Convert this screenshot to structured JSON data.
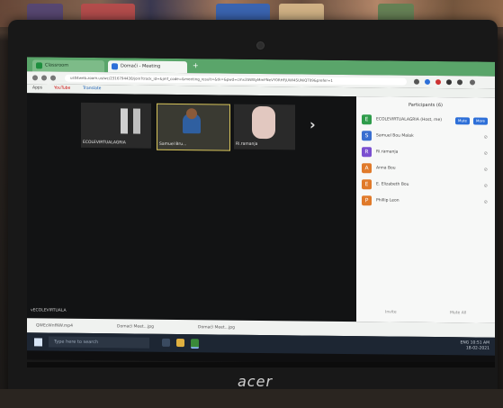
{
  "browser": {
    "tabs": [
      {
        "label": "Classroom"
      },
      {
        "label": "Domaći - Meeting"
      }
    ],
    "url": "us04web.zoom.us/wc/2316794438/join?track_id=&jmf_code=&meeting_result=&tk=&pwd=cmx3SW8yMmFNeVY0RHFjUWl4SUNiQT09&prefer=1",
    "bookmarks": [
      "Apps",
      "YouTube",
      "Translate"
    ]
  },
  "meeting": {
    "participants_video": [
      {
        "label": "ECOLEVIRTUALAGRIA"
      },
      {
        "label": "Samuel Bru..."
      },
      {
        "label": "Ri.ramanja"
      }
    ],
    "footer_name": "vECOLEVIRTUALA"
  },
  "participants_panel": {
    "title": "Participants (6)",
    "rows": [
      {
        "initial": "E",
        "color": "#2e9c4a",
        "name": "ECOLEVIRTUALAGRIA (Host, me)",
        "actions": [
          "Mute",
          "More"
        ]
      },
      {
        "initial": "S",
        "color": "#3a6fd0",
        "name": "Samuel Bou Malak",
        "actions": []
      },
      {
        "initial": "R",
        "color": "#7a4fd0",
        "name": "Ri.ramanja",
        "actions": []
      },
      {
        "initial": "A",
        "color": "#e07a2a",
        "name": "Anna Bou",
        "actions": []
      },
      {
        "initial": "E",
        "color": "#e07a2a",
        "name": "E. Elizabeth Bou",
        "actions": []
      },
      {
        "initial": "P",
        "color": "#e07a2a",
        "name": "Phillip Leon",
        "actions": []
      }
    ],
    "footer": [
      "Invite",
      "Mute All"
    ]
  },
  "downloads": [
    {
      "label": "QWEcWnfNW.mp4"
    },
    {
      "label": "Domaći Meet...jpg"
    },
    {
      "label": "Domaći Meet...jpg"
    }
  ],
  "taskbar": {
    "search_placeholder": "Type here to search",
    "time": "10:51 AM",
    "date": "18-02-2021",
    "lang": "ENG"
  },
  "laptop": {
    "brand": "acer"
  }
}
